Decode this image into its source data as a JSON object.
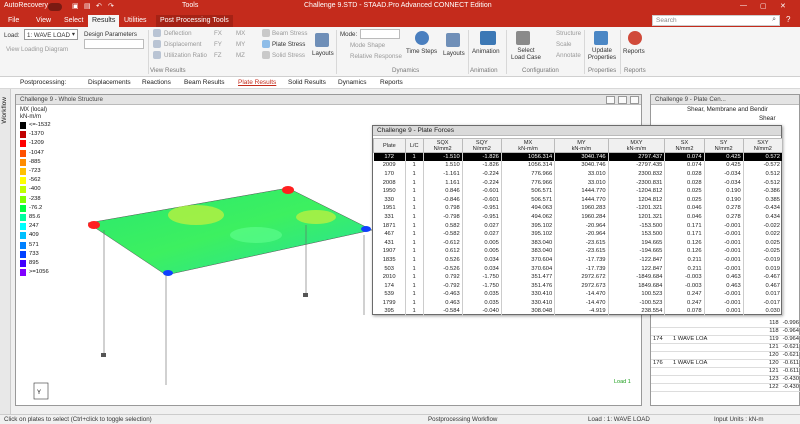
{
  "titlebar": {
    "autorecovery": "AutoRecovery",
    "tools": "Tools",
    "title": "Challenge 9.STD - STAAD.Pro Advanced CONNECT Edition",
    "search_placeholder": "Search"
  },
  "ribbon_tabs": [
    "File",
    "View",
    "Select",
    "Results",
    "Utilities",
    "Post Processing Tools"
  ],
  "ribbon": {
    "load_label": "Load:",
    "load_value": "1: WAVE LOAD",
    "view_loading_diagram": "View Loading Diagram",
    "design_parameters": "Design Parameters",
    "deflection": "Deflection",
    "displacement": "Displacement",
    "utilization_ratio": "Utilization Ratio",
    "fx": "FX",
    "fy": "FY",
    "fz": "FZ",
    "mx": "MX",
    "my": "MY",
    "mz": "MZ",
    "beam_stress": "Beam Stress",
    "plate_stress": "Plate Stress",
    "solid_stress": "Solid Stress",
    "layouts": "Layouts",
    "mode_label": "Mode:",
    "mode_shape": "Mode Shape",
    "relative_response": "Relative Response",
    "time_steps": "Time Steps",
    "layouts2": "Layouts",
    "animation": "Animation",
    "select_load_case": "Select Load Case",
    "structure": "Structure",
    "scale": "Scale",
    "annotate": "Annotate",
    "update_properties": "Update Properties",
    "reports": "Reports",
    "groups": [
      "View Results",
      "Dynamics",
      "Animation",
      "Configuration",
      "Properties",
      "Reports"
    ]
  },
  "pp_bar": {
    "postprocessing": "Postprocessing:",
    "tabs": [
      "Displacements",
      "Reactions",
      "Beam Results",
      "Plate Results",
      "Solid Results",
      "Dynamics",
      "Reports"
    ]
  },
  "left_strip": {
    "workflow": "Workflow"
  },
  "whole_structure": {
    "title": "Challenge 9 - Whole Structure",
    "legend_title": "MX (local)",
    "legend_unit": "kN-m/m",
    "legend": [
      {
        "label": "<=-1532",
        "color": "#000000"
      },
      {
        "label": "-1370",
        "color": "#c00000"
      },
      {
        "label": "-1209",
        "color": "#ff0000"
      },
      {
        "label": "-1047",
        "color": "#ff5000"
      },
      {
        "label": "-885",
        "color": "#ff8c00"
      },
      {
        "label": "-723",
        "color": "#ffc000"
      },
      {
        "label": "-562",
        "color": "#ffff00"
      },
      {
        "label": "-400",
        "color": "#c0ff00"
      },
      {
        "label": "-238",
        "color": "#80ff00"
      },
      {
        "label": "-76.2",
        "color": "#00ff40"
      },
      {
        "label": "85.6",
        "color": "#00ffa0"
      },
      {
        "label": "247",
        "color": "#00ffff"
      },
      {
        "label": "409",
        "color": "#00c0ff"
      },
      {
        "label": "571",
        "color": "#0080ff"
      },
      {
        "label": "733",
        "color": "#0040ff"
      },
      {
        "label": "895",
        "color": "#4000ff"
      },
      {
        "label": ">=1056",
        "color": "#8000ff"
      }
    ],
    "load_caption": "Load 1"
  },
  "plate_forces": {
    "title": "Challenge 9 - Plate Forces",
    "headers": [
      {
        "top": "Plate",
        "bottom": ""
      },
      {
        "top": "L/C",
        "bottom": ""
      },
      {
        "top": "SQX",
        "bottom": "N/mm2"
      },
      {
        "top": "SQY",
        "bottom": "N/mm2"
      },
      {
        "top": "MX",
        "bottom": "kN-m/m"
      },
      {
        "top": "MY",
        "bottom": "kN-m/m"
      },
      {
        "top": "MXY",
        "bottom": "kN-m/m"
      },
      {
        "top": "SX",
        "bottom": "N/mm2"
      },
      {
        "top": "SY",
        "bottom": "N/mm2"
      },
      {
        "top": "SXY",
        "bottom": "N/mm2"
      }
    ],
    "rows": [
      [
        "172",
        "1",
        "-1.510",
        "-1.826",
        "1056.314",
        "3040.746",
        "2797.437",
        "0.074",
        "0.425",
        "0.572"
      ],
      [
        "2009",
        "1",
        "1.510",
        "-1.826",
        "1056.314",
        "3040.746",
        "-2797.435",
        "0.074",
        "0.425",
        "-0.572"
      ],
      [
        "170",
        "1",
        "-1.161",
        "-0.224",
        "776.966",
        "33.010",
        "2300.832",
        "0.028",
        "-0.034",
        "0.512"
      ],
      [
        "2008",
        "1",
        "1.161",
        "-0.224",
        "776.966",
        "33.010",
        "-2300.831",
        "0.028",
        "-0.034",
        "-0.512"
      ],
      [
        "1950",
        "1",
        "0.846",
        "-0.601",
        "506.571",
        "1444.770",
        "-1204.812",
        "0.025",
        "0.190",
        "-0.386"
      ],
      [
        "330",
        "1",
        "-0.846",
        "-0.601",
        "506.571",
        "1444.770",
        "1204.812",
        "0.025",
        "0.190",
        "0.385"
      ],
      [
        "1951",
        "1",
        "0.798",
        "-0.951",
        "494.063",
        "1960.283",
        "-1201.321",
        "0.046",
        "0.278",
        "-0.434"
      ],
      [
        "331",
        "1",
        "-0.798",
        "-0.951",
        "494.062",
        "1960.284",
        "1201.321",
        "0.046",
        "0.278",
        "0.434"
      ],
      [
        "1871",
        "1",
        "0.582",
        "0.027",
        "395.102",
        "-20.964",
        "-153.500",
        "0.171",
        "-0.001",
        "-0.022"
      ],
      [
        "467",
        "1",
        "-0.582",
        "0.027",
        "395.102",
        "-20.964",
        "153.500",
        "0.171",
        "-0.001",
        "0.022"
      ],
      [
        "431",
        "1",
        "-0.612",
        "0.005",
        "383.040",
        "-23.615",
        "194.665",
        "0.126",
        "-0.001",
        "0.025"
      ],
      [
        "1907",
        "1",
        "0.612",
        "0.005",
        "383.040",
        "-23.615",
        "-194.665",
        "0.126",
        "-0.001",
        "-0.025"
      ],
      [
        "1835",
        "1",
        "0.526",
        "0.034",
        "370.604",
        "-17.739",
        "-122.847",
        "0.211",
        "-0.001",
        "-0.019"
      ],
      [
        "503",
        "1",
        "-0.526",
        "0.034",
        "370.604",
        "-17.739",
        "122.847",
        "0.211",
        "-0.001",
        "0.019"
      ],
      [
        "2010",
        "1",
        "0.792",
        "-1.750",
        "351.477",
        "2972.672",
        "-1849.684",
        "-0.003",
        "0.463",
        "-0.467"
      ],
      [
        "174",
        "1",
        "-0.792",
        "-1.750",
        "351.476",
        "2972.673",
        "1849.684",
        "-0.003",
        "0.463",
        "0.467"
      ],
      [
        "539",
        "1",
        "-0.463",
        "0.035",
        "330.410",
        "-14.470",
        "100.523",
        "0.247",
        "-0.001",
        "0.017"
      ],
      [
        "1799",
        "1",
        "0.463",
        "0.035",
        "330.410",
        "-14.470",
        "-100.523",
        "0.247",
        "-0.001",
        "-0.017"
      ],
      [
        "395",
        "1",
        "-0.584",
        "-0.040",
        "308.048",
        "-4.919",
        "238.554",
        "0.078",
        "0.001",
        "0.030"
      ]
    ]
  },
  "plate_centre": {
    "title": "Challenge 9 - Plate Cen...",
    "heading": "Shear, Membrane and Bendir",
    "subheading": "Shear",
    "rows": [
      {
        "a": "",
        "b": "",
        "c": "118",
        "d": "-0.996"
      },
      {
        "a": "",
        "b": "",
        "c": "118",
        "d": "-0.964"
      },
      {
        "a": "174",
        "b": "1 WAVE LOA",
        "c": "119",
        "d": "-0.964"
      },
      {
        "a": "",
        "b": "",
        "c": "121",
        "d": "-0.621"
      },
      {
        "a": "",
        "b": "",
        "c": "120",
        "d": "-0.621"
      },
      {
        "a": "176",
        "b": "1 WAVE LOA",
        "c": "120",
        "d": "-0.611"
      },
      {
        "a": "",
        "b": "",
        "c": "121",
        "d": "-0.611"
      },
      {
        "a": "",
        "b": "",
        "c": "123",
        "d": "-0.430"
      },
      {
        "a": "",
        "b": "",
        "c": "122",
        "d": "-0.430"
      }
    ]
  },
  "status": {
    "hint": "Click on plates to select (Ctrl+click to toggle selection)",
    "workflow": "Postprocessing Workflow",
    "load": "Load : 1: WAVE LOAD",
    "units": "Input Units : kN-m"
  }
}
